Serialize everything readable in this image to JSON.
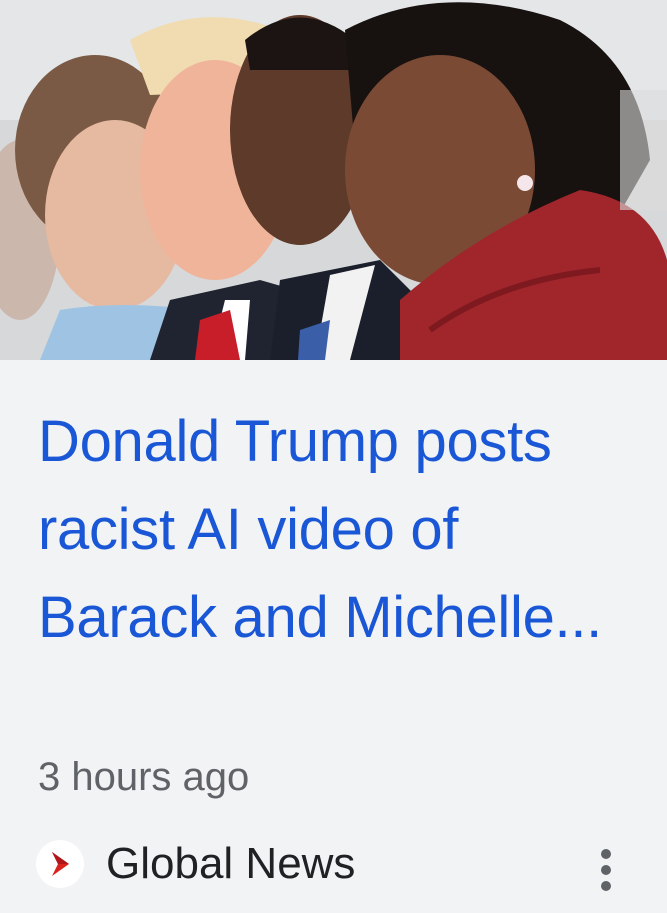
{
  "article": {
    "image_alt": "Photo of Melania Trump, Donald Trump, Barack Obama and Michelle Obama",
    "headline": "Donald Trump posts racist AI video of Barack and Michelle...",
    "timestamp": "3 hours ago",
    "source_name": "Global News",
    "source_icon": "global-news-logo-icon",
    "menu_icon": "more-vert-icon"
  },
  "colors": {
    "headline": "#1a57d6",
    "timestamp": "#5f6368",
    "source": "#202124",
    "card_bg": "#f1f3f4",
    "brand": "#d9221c"
  }
}
